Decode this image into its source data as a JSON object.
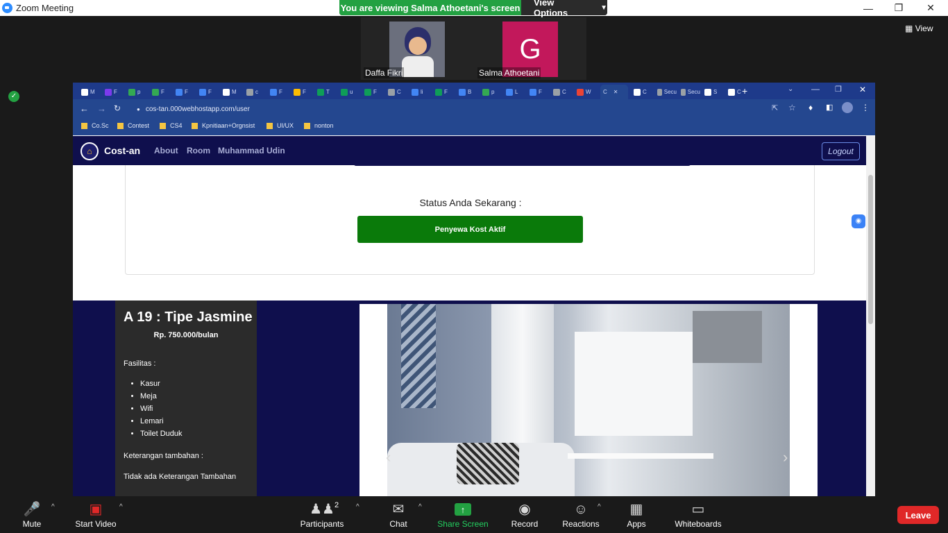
{
  "zoom": {
    "window_title": "Zoom Meeting",
    "viewing_banner": "You are viewing Salma Athoetani's screen",
    "view_options": "View Options",
    "view_toggle": "View",
    "participants": [
      {
        "name": "Daffa Fikri"
      },
      {
        "name": "Salma Athoetani",
        "initial": "G"
      }
    ],
    "toolbar": {
      "mute": "Mute",
      "start_video": "Start Video",
      "participants": "Participants",
      "participants_count": "2",
      "chat": "Chat",
      "share_screen": "Share Screen",
      "record": "Record",
      "reactions": "Reactions",
      "apps": "Apps",
      "whiteboards": "Whiteboards",
      "leave": "Leave"
    },
    "colors": {
      "share_green": "#23a142",
      "leave_red": "#e02828",
      "banner_green": "#23a142"
    }
  },
  "browser": {
    "active_tab": "C",
    "tabs": [
      "M",
      "F",
      "p",
      "F",
      "F",
      "F",
      "M",
      "c",
      "F",
      "F",
      "T",
      "u",
      "F",
      "C",
      "li",
      "F",
      "B",
      "p",
      "L",
      "F",
      "C",
      "W",
      "C",
      "Secu",
      "Secu",
      "S",
      "C"
    ],
    "url": "cos-tan.000webhostapp.com/user",
    "bookmarks": [
      "Co.Sc",
      "Contest",
      "CS4",
      "Kpnitiaan+Orgnsist",
      "UI/UX",
      "nonton"
    ]
  },
  "site": {
    "brand": "Cost-an",
    "nav": [
      "About",
      "Room",
      "Muhammad Udin"
    ],
    "logout": "Logout",
    "status_label": "Status Anda Sekarang :",
    "status_value": "Penyewa Kost Aktif",
    "room": {
      "title": "A 19 : Tipe Jasmine",
      "price": "Rp. 750.000/bulan",
      "facilities_label": "Fasilitas :",
      "facilities": [
        "Kasur",
        "Meja",
        "Wifi",
        "Lemari",
        "Toilet Duduk"
      ],
      "extra_label": "Keterangan tambahan :",
      "extra_value": "Tidak ada Keterangan Tambahan"
    },
    "colors": {
      "navy": "#0f0f4d",
      "status_green": "#0a7a0a"
    }
  }
}
